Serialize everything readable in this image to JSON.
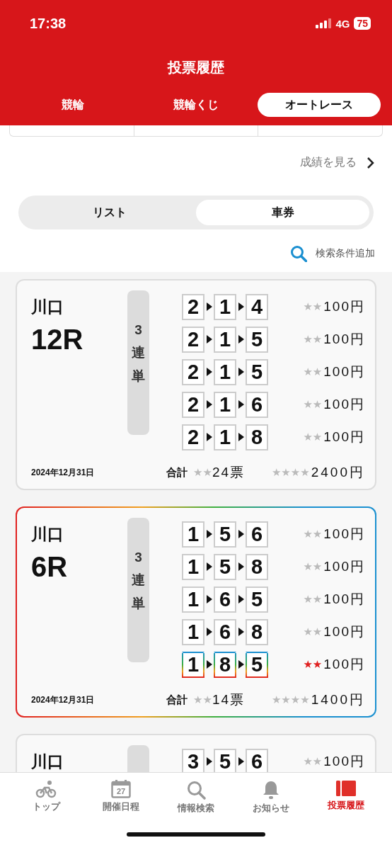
{
  "status_bar": {
    "time": "17:38",
    "network": "4G",
    "battery": "75"
  },
  "header": {
    "title": "投票履歴"
  },
  "category_tabs": [
    {
      "label": "競輪",
      "selected": false
    },
    {
      "label": "競輪くじ",
      "selected": false
    },
    {
      "label": "オートレース",
      "selected": true
    }
  ],
  "results_link": "成績を見る",
  "view_toggle": [
    {
      "label": "リスト",
      "selected": false
    },
    {
      "label": "車券",
      "selected": true
    }
  ],
  "search_filter": "検索条件追加",
  "tickets": [
    {
      "venue": "川口",
      "race": "12R",
      "bet_type": "3連単",
      "hit": false,
      "bets": [
        {
          "numbers": [
            "2",
            "1",
            "4"
          ],
          "mask": "★★",
          "amount": "100円",
          "hit": false
        },
        {
          "numbers": [
            "2",
            "1",
            "5"
          ],
          "mask": "★★",
          "amount": "100円",
          "hit": false
        },
        {
          "numbers": [
            "2",
            "1",
            "5"
          ],
          "mask": "★★",
          "amount": "100円",
          "hit": false
        },
        {
          "numbers": [
            "2",
            "1",
            "6"
          ],
          "mask": "★★",
          "amount": "100円",
          "hit": false
        },
        {
          "numbers": [
            "2",
            "1",
            "8"
          ],
          "mask": "★★",
          "amount": "100円",
          "hit": false
        }
      ],
      "date": "2024年12月31日",
      "total": {
        "label": "合計",
        "count_mask": "★★",
        "count": "24票",
        "amount_mask": "★★★★",
        "amount": "2400円"
      }
    },
    {
      "venue": "川口",
      "race": "6R",
      "bet_type": "3連単",
      "hit": true,
      "bets": [
        {
          "numbers": [
            "1",
            "5",
            "6"
          ],
          "mask": "★★",
          "amount": "100円",
          "hit": false
        },
        {
          "numbers": [
            "1",
            "5",
            "8"
          ],
          "mask": "★★",
          "amount": "100円",
          "hit": false
        },
        {
          "numbers": [
            "1",
            "6",
            "5"
          ],
          "mask": "★★",
          "amount": "100円",
          "hit": false
        },
        {
          "numbers": [
            "1",
            "6",
            "8"
          ],
          "mask": "★★",
          "amount": "100円",
          "hit": false
        },
        {
          "numbers": [
            "1",
            "8",
            "5"
          ],
          "mask": "★★",
          "amount": "100円",
          "hit": true
        }
      ],
      "date": "2024年12月31日",
      "total": {
        "label": "合計",
        "count_mask": "★★",
        "count": "14票",
        "amount_mask": "★★★★",
        "amount": "1400円"
      }
    },
    {
      "venue": "川口",
      "hit": false,
      "bets": [
        {
          "numbers": [
            "3",
            "5",
            "6"
          ],
          "mask": "★★",
          "amount": "100円",
          "hit": false
        }
      ]
    }
  ],
  "bottom_nav": [
    {
      "label": "トップ",
      "kind": "bike",
      "selected": false
    },
    {
      "label": "開催日程",
      "kind": "calendar",
      "day": "27",
      "selected": false
    },
    {
      "label": "情報検索",
      "kind": "search",
      "selected": false
    },
    {
      "label": "お知らせ",
      "kind": "bell",
      "selected": false
    },
    {
      "label": "投票履歴",
      "kind": "ticket",
      "selected": true
    }
  ]
}
